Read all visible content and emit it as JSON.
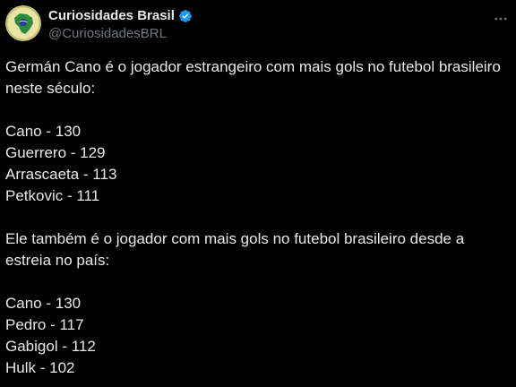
{
  "author": {
    "display_name": "Curiosidades Brasil",
    "handle": "@CuriosidadesBRL",
    "verified_icon": "verified-badge-icon",
    "avatar_icon": "brazil-map-avatar-icon"
  },
  "menu": {
    "more_icon": "more-horizontal-icon"
  },
  "tweet": {
    "intro": [
      "Germán Cano é o jogador estrangeiro com mais gols no futebol brasileiro",
      "neste século:"
    ],
    "list1": [
      "Cano - 130",
      "Guerrero - 129",
      "Arrascaeta - 113",
      "Petkovic - 111"
    ],
    "second_intro": [
      "Ele também é o jogador com mais gols no futebol brasileiro desde a",
      "estreia no país:"
    ],
    "list2": [
      "Cano - 130",
      "Pedro - 117",
      "Gabigol - 112",
      "Hulk - 102"
    ]
  },
  "colors": {
    "background": "#000000",
    "text": "#e7e9ea",
    "secondary_text": "#71767b",
    "verified_blue": "#1d9bf0"
  }
}
